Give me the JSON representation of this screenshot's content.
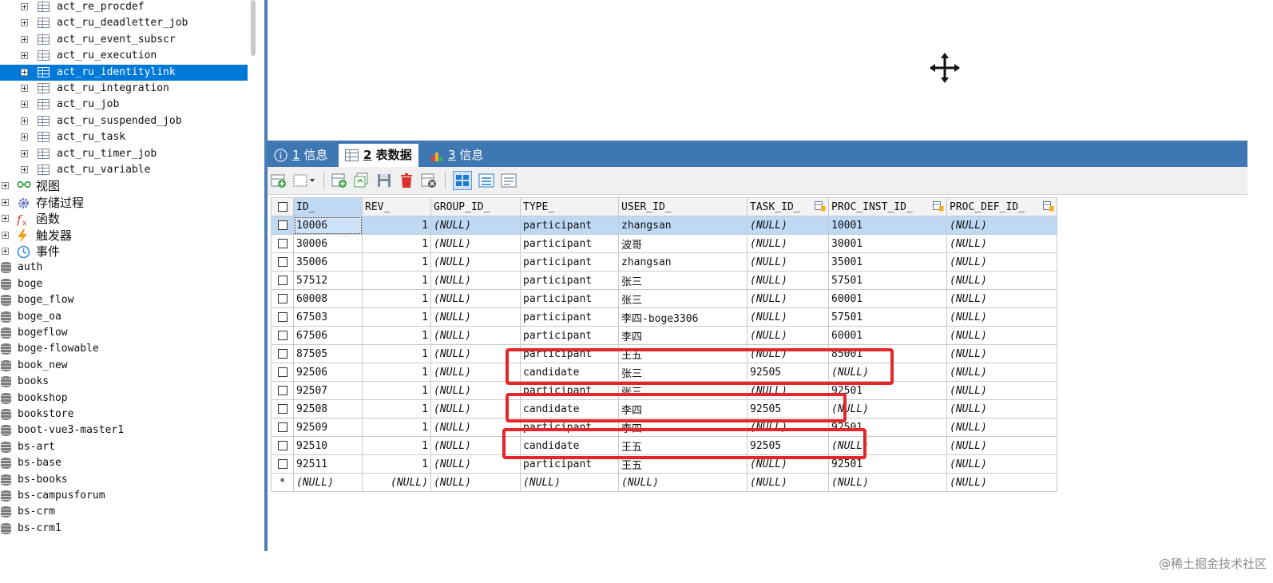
{
  "sidebar": {
    "tables": [
      {
        "name": "act_re_procdef",
        "selected": false
      },
      {
        "name": "act_ru_deadletter_job",
        "selected": false
      },
      {
        "name": "act_ru_event_subscr",
        "selected": false
      },
      {
        "name": "act_ru_execution",
        "selected": false
      },
      {
        "name": "act_ru_identitylink",
        "selected": true
      },
      {
        "name": "act_ru_integration",
        "selected": false
      },
      {
        "name": "act_ru_job",
        "selected": false
      },
      {
        "name": "act_ru_suspended_job",
        "selected": false
      },
      {
        "name": "act_ru_task",
        "selected": false
      },
      {
        "name": "act_ru_timer_job",
        "selected": false
      },
      {
        "name": "act_ru_variable",
        "selected": false
      }
    ],
    "categories": [
      {
        "name": "视图",
        "icon": "view-icon",
        "color": "#2e9b3a"
      },
      {
        "name": "存储过程",
        "icon": "gear-icon",
        "color": "#6b7fc4"
      },
      {
        "name": "函数",
        "icon": "function-icon",
        "color": "#d03a2a"
      },
      {
        "name": "触发器",
        "icon": "lightning-icon",
        "color": "#f0a020"
      },
      {
        "name": "事件",
        "icon": "clock-icon",
        "color": "#3a8fd8"
      }
    ],
    "databases": [
      "auth",
      "boge",
      "boge_flow",
      "boge_oa",
      "bogeflow",
      "boge-flowable",
      "book_new",
      "books",
      "bookshop",
      "bookstore",
      "boot-vue3-master1",
      "bs-art",
      "bs-base",
      "bs-books",
      "bs-campusforum",
      "bs-crm",
      "bs-crm1"
    ]
  },
  "tabs": [
    {
      "num": "1",
      "label": " 信息",
      "icon": "info-icon",
      "active": false
    },
    {
      "num": "2",
      "label": " 表数据",
      "icon": "table-icon",
      "active": true
    },
    {
      "num": "3",
      "label": " 信息",
      "icon": "chart-icon",
      "active": false
    }
  ],
  "grid": {
    "columns": [
      "ID_",
      "REV_",
      "GROUP_ID_",
      "TYPE_",
      "USER_ID_",
      "TASK_ID_",
      "PROC_INST_ID_",
      "PROC_DEF_ID_"
    ],
    "rows": [
      [
        "10006",
        "1",
        "(NULL)",
        "participant",
        "zhangsan",
        "(NULL)",
        "10001",
        "(NULL)"
      ],
      [
        "30006",
        "1",
        "(NULL)",
        "participant",
        "波哥",
        "(NULL)",
        "30001",
        "(NULL)"
      ],
      [
        "35006",
        "1",
        "(NULL)",
        "participant",
        "zhangsan",
        "(NULL)",
        "35001",
        "(NULL)"
      ],
      [
        "57512",
        "1",
        "(NULL)",
        "participant",
        "张三",
        "(NULL)",
        "57501",
        "(NULL)"
      ],
      [
        "60008",
        "1",
        "(NULL)",
        "participant",
        "张三",
        "(NULL)",
        "60001",
        "(NULL)"
      ],
      [
        "67503",
        "1",
        "(NULL)",
        "participant",
        "李四-boge3306",
        "(NULL)",
        "57501",
        "(NULL)"
      ],
      [
        "67506",
        "1",
        "(NULL)",
        "participant",
        "李四",
        "(NULL)",
        "60001",
        "(NULL)"
      ],
      [
        "87505",
        "1",
        "(NULL)",
        "participant",
        "王五",
        "(NULL)",
        "85001",
        "(NULL)"
      ],
      [
        "92506",
        "1",
        "(NULL)",
        "candidate",
        "张三",
        "92505",
        "(NULL)",
        "(NULL)"
      ],
      [
        "92507",
        "1",
        "(NULL)",
        "participant",
        "张三",
        "(NULL)",
        "92501",
        "(NULL)"
      ],
      [
        "92508",
        "1",
        "(NULL)",
        "candidate",
        "李四",
        "92505",
        "(NULL)",
        "(NULL)"
      ],
      [
        "92509",
        "1",
        "(NULL)",
        "participant",
        "李四",
        "(NULL)",
        "92501",
        "(NULL)"
      ],
      [
        "92510",
        "1",
        "(NULL)",
        "candidate",
        "王五",
        "92505",
        "(NULL)",
        "(NULL)"
      ],
      [
        "92511",
        "1",
        "(NULL)",
        "participant",
        "王五",
        "(NULL)",
        "92501",
        "(NULL)"
      ]
    ],
    "new_row": [
      "(NULL)",
      "(NULL)",
      "(NULL)",
      "(NULL)",
      "(NULL)",
      "(NULL)",
      "(NULL)",
      "(NULL)"
    ],
    "new_row_marker": "*",
    "accent_color": "#e3262a"
  },
  "watermark": "@稀土掘金技术社区"
}
